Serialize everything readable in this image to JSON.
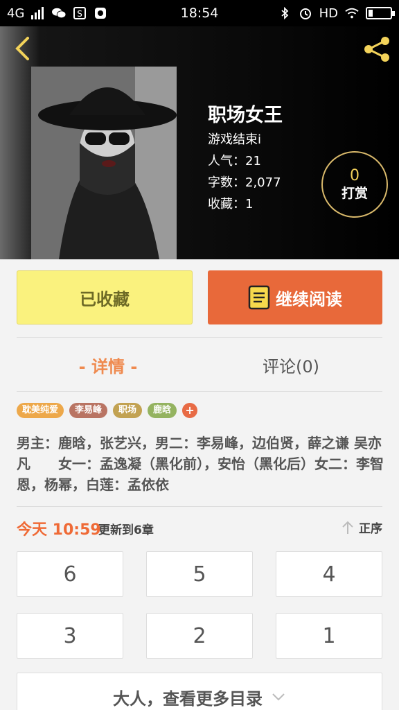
{
  "status_bar": {
    "network": "4G",
    "time": "18:54",
    "hd": "HD"
  },
  "book": {
    "title": "职场女王",
    "author": "游戏结束i",
    "popularity": "人气：21",
    "word_count": "字数：2,077",
    "favorites": "收藏：1"
  },
  "tip": {
    "count": "0",
    "label": "打赏"
  },
  "actions": {
    "collected_label": "已收藏",
    "continue_label": "继续阅读"
  },
  "tabs": {
    "details": "- 详情 -",
    "comments": "评论(0)"
  },
  "tags": [
    {
      "label": "耽美纯爱",
      "color": "#eda84a"
    },
    {
      "label": "李易峰",
      "color": "#b97463"
    },
    {
      "label": "职场",
      "color": "#c2a252"
    },
    {
      "label": "鹿晗",
      "color": "#94b360"
    },
    {
      "label": "+",
      "color": "#e86b45"
    }
  ],
  "description": "男主：鹿晗，张艺兴，男二：李易峰，边伯贤，薛之谦 吴亦凡　　女一：孟逸凝（黑化前），安怡（黑化后）女二：李智恩，杨幂，白莲：孟依依",
  "update": {
    "time": "今天 10:59",
    "info": "更新到6章",
    "sort_label": "正序"
  },
  "chapters": [
    "6",
    "5",
    "4",
    "3",
    "2",
    "1"
  ],
  "more_toc_label": "大人，查看更多目录"
}
